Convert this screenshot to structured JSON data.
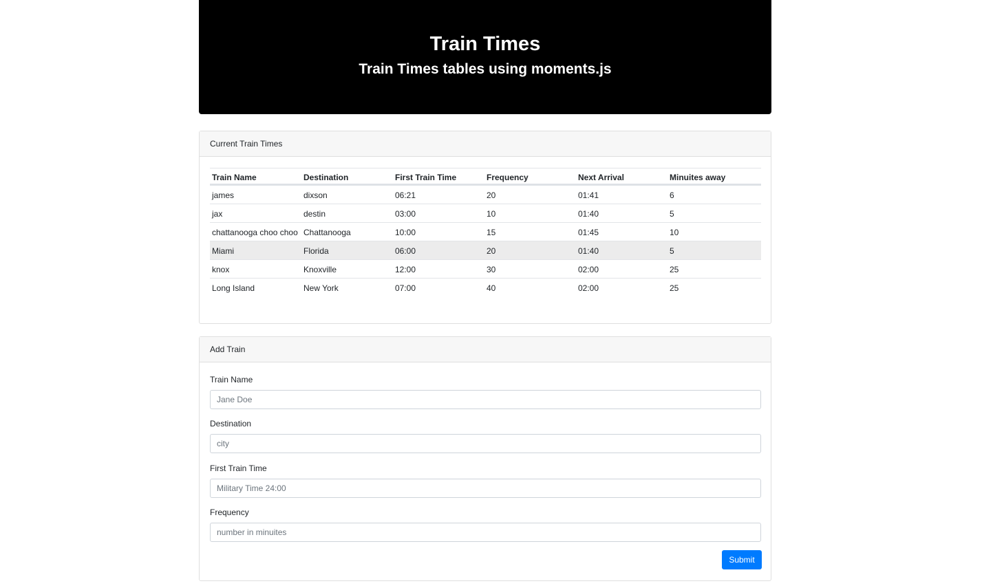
{
  "header": {
    "title": "Train Times",
    "subtitle": "Train Times tables using moments.js"
  },
  "times_panel": {
    "title": "Current Train Times",
    "columns": [
      "Train Name",
      "Destination",
      "First Train Time",
      "Frequency",
      "Next Arrival",
      "Minuites away"
    ],
    "rows": [
      [
        "james",
        "dixson",
        "06:21",
        "20",
        "01:41",
        "6"
      ],
      [
        "jax",
        "destin",
        "03:00",
        "10",
        "01:40",
        "5"
      ],
      [
        "chattanooga choo choo",
        "Chattanooga",
        "10:00",
        "15",
        "01:45",
        "10"
      ],
      [
        "Miami",
        "Florida",
        "06:00",
        "20",
        "01:40",
        "5"
      ],
      [
        "knox",
        "Knoxville",
        "12:00",
        "30",
        "02:00",
        "25"
      ],
      [
        "Long Island",
        "New York",
        "07:00",
        "40",
        "02:00",
        "25"
      ]
    ]
  },
  "add_panel": {
    "title": "Add Train",
    "fields": [
      {
        "label": "Train Name",
        "placeholder": "Jane Doe"
      },
      {
        "label": "Destination",
        "placeholder": "city"
      },
      {
        "label": "First Train Time",
        "placeholder": "Military Time 24:00"
      },
      {
        "label": "Frequency",
        "placeholder": "number in minuites"
      }
    ],
    "submit_label": "Submit"
  },
  "colors": {
    "header_bg": "#000000",
    "submit_bg": "#007bff",
    "row_hover_bg": "#ececec"
  }
}
